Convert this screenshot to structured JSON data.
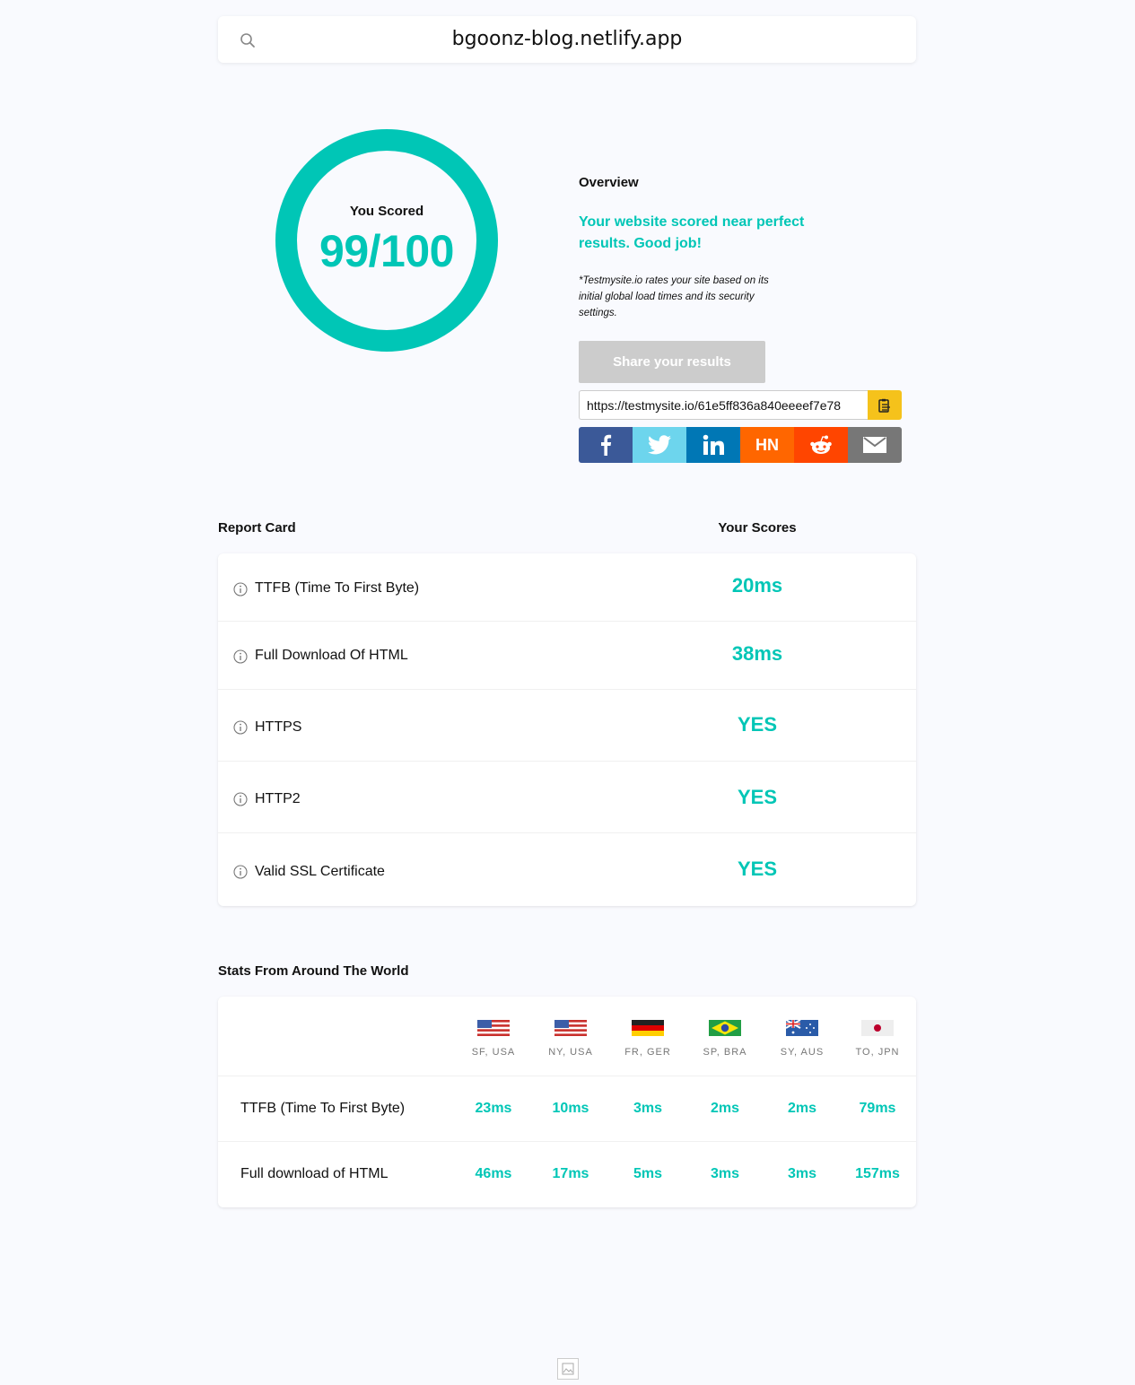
{
  "search": {
    "query": "bgoonz-blog.netlify.app"
  },
  "score": {
    "label": "You Scored",
    "value": "99/100"
  },
  "overview": {
    "title": "Overview",
    "message": "Your website scored near perfect results. Good job!",
    "note": "*Testmysite.io rates your site based on its initial global load times and its security settings.",
    "share_label": "Share your results",
    "share_url": "https://testmysite.io/61e5ff836a840eeeef7e78",
    "social": [
      "facebook",
      "twitter",
      "linkedin",
      "HN",
      "reddit",
      "email"
    ]
  },
  "report": {
    "title": "Report Card",
    "scores_title": "Your Scores",
    "rows": [
      {
        "metric": "TTFB (Time To First Byte)",
        "value": "20ms"
      },
      {
        "metric": "Full Download Of HTML",
        "value": "38ms"
      },
      {
        "metric": "HTTPS",
        "value": "YES"
      },
      {
        "metric": "HTTP2",
        "value": "YES"
      },
      {
        "metric": "Valid SSL Certificate",
        "value": "YES"
      }
    ]
  },
  "world": {
    "title": "Stats From Around The World",
    "locations": [
      "SF, USA",
      "NY, USA",
      "FR, GER",
      "SP, BRA",
      "SY, AUS",
      "TO, JPN"
    ],
    "rows": [
      {
        "metric": "TTFB (Time To First Byte)",
        "values": [
          "23ms",
          "10ms",
          "3ms",
          "2ms",
          "2ms",
          "79ms"
        ]
      },
      {
        "metric": "Full download of HTML",
        "values": [
          "46ms",
          "17ms",
          "5ms",
          "3ms",
          "3ms",
          "157ms"
        ]
      }
    ]
  },
  "colors": {
    "accent": "#00c6b6",
    "share_disabled": "#cccccc",
    "copy": "#f5c21b",
    "facebook": "#3b5998",
    "twitter": "#6dd5ed",
    "linkedin": "#0077b5",
    "hn": "#ff6600",
    "reddit": "#ff4500",
    "email": "#777777"
  }
}
